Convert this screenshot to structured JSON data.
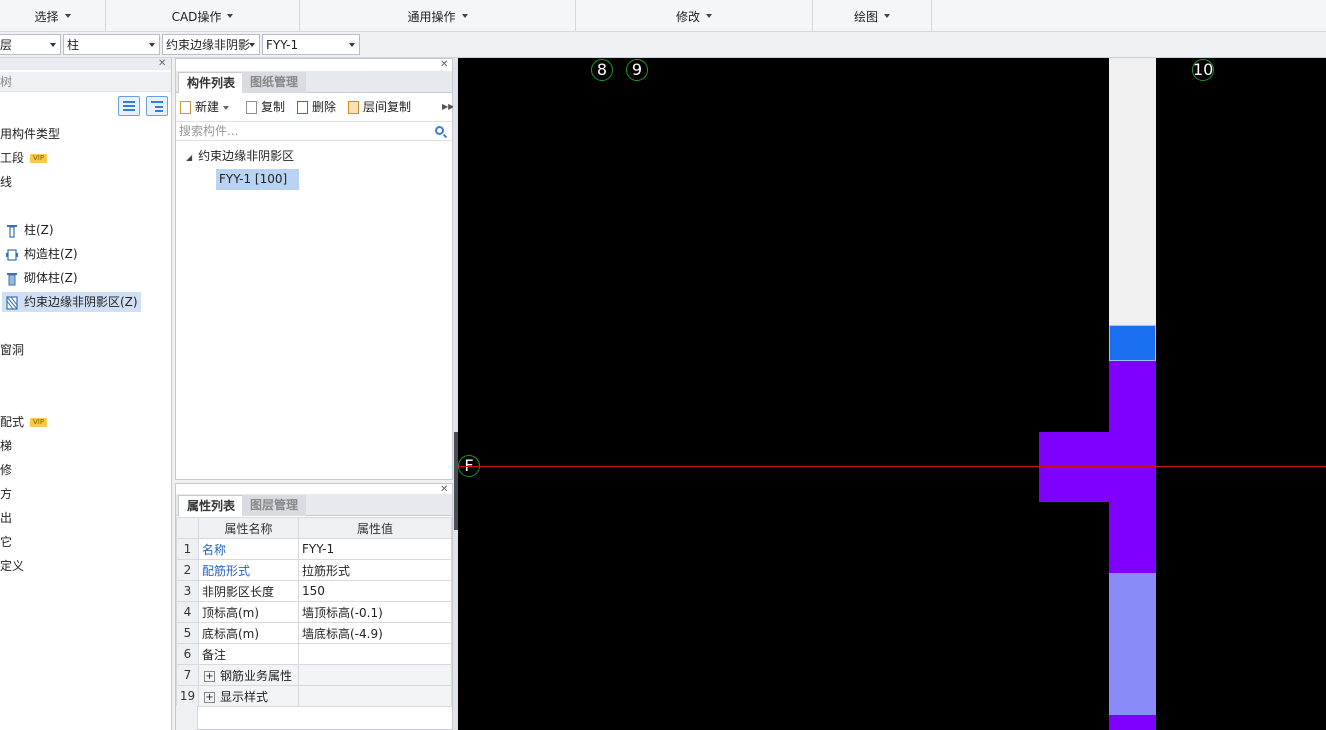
{
  "ribbon": {
    "groups": [
      {
        "label": "选择"
      },
      {
        "label": "CAD操作"
      },
      {
        "label": "通用操作"
      },
      {
        "label": "修改"
      },
      {
        "label": "绘图"
      }
    ]
  },
  "selectors": {
    "floor": "层",
    "category": "柱",
    "type": "约束边缘非阴影",
    "component": "FYY-1"
  },
  "left_panel": {
    "title": "树",
    "items": [
      {
        "label": "用构件类型"
      },
      {
        "label": "工段",
        "badge": "VIP"
      },
      {
        "label": "线"
      },
      {
        "label": "柱(Z)",
        "icon": "column-icon"
      },
      {
        "label": "构造柱(Z)",
        "icon": "constructional-column-icon"
      },
      {
        "label": "砌体柱(Z)",
        "icon": "masonry-column-icon"
      },
      {
        "label": "约束边缘非阴影区(Z)",
        "icon": "boundary-zone-icon",
        "selected": true
      },
      {
        "label": "窗洞"
      },
      {
        "label": "配式",
        "badge": "VIP"
      },
      {
        "label": "梯"
      },
      {
        "label": "修"
      },
      {
        "label": "方"
      },
      {
        "label": "出"
      },
      {
        "label": "它"
      },
      {
        "label": "定义"
      }
    ]
  },
  "component_panel": {
    "tabs": [
      "构件列表",
      "图纸管理"
    ],
    "toolbar": {
      "new": "新建",
      "copy": "复制",
      "delete": "删除",
      "layer_copy": "层间复制"
    },
    "search_placeholder": "搜索构件...",
    "tree": {
      "group": "约束边缘非阴影区",
      "item": "FYY-1 [100]"
    }
  },
  "property_panel": {
    "tabs": [
      "属性列表",
      "图层管理"
    ],
    "headers": {
      "name": "属性名称",
      "value": "属性值"
    },
    "rows": [
      {
        "idx": "1",
        "name": "名称",
        "value": "FYY-1",
        "blue": true
      },
      {
        "idx": "2",
        "name": "配筋形式",
        "value": "拉筋形式",
        "blue": true
      },
      {
        "idx": "3",
        "name": "非阴影区长度",
        "value": "150"
      },
      {
        "idx": "4",
        "name": "顶标高(m)",
        "value": "墙顶标高(-0.1)"
      },
      {
        "idx": "5",
        "name": "底标高(m)",
        "value": "墙底标高(-4.9)"
      },
      {
        "idx": "6",
        "name": "备注",
        "value": ""
      },
      {
        "idx": "7",
        "name": "钢筋业务属性",
        "value": "",
        "expand": "+"
      },
      {
        "idx": "19",
        "name": "显示样式",
        "value": "",
        "expand": "+"
      }
    ]
  },
  "canvas": {
    "axes": {
      "a8": "8",
      "a9": "9",
      "a10": "10",
      "f": "F"
    },
    "colors": {
      "background": "#000000",
      "wall_white": "#f0f0f0",
      "selected_blue": "#1a6ff0",
      "purple": "#8000ff",
      "light_purple": "#8a8af8",
      "axis_green": "#1e9a2a",
      "axis_red": "#d01010"
    }
  }
}
